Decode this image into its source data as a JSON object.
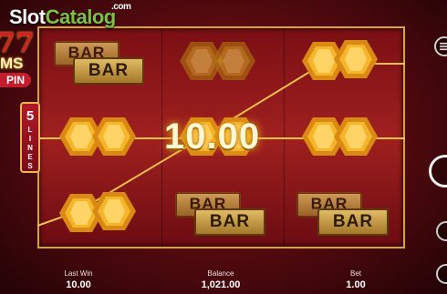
{
  "watermark": {
    "slot": "Slot",
    "catalog": "Catalog",
    "dotcom": ".com"
  },
  "game_logo": {
    "sevens": "77",
    "title_fragment": "MS",
    "spin_fragment": "PIN"
  },
  "lines_badge": {
    "number": "5",
    "word": "LINES"
  },
  "win": {
    "amount": "10.00"
  },
  "symbols": {
    "bar_label": "BAR"
  },
  "hud": {
    "last_win_label": "Last Win",
    "last_win_value": "10.00",
    "balance_label": "Balance",
    "balance_value": "1,021.00",
    "bet_label": "Bet",
    "bet_value": "1.00"
  },
  "colors": {
    "frame_gold": "#d7a531",
    "reel_red": "#a0201f",
    "win_glow": "#f4b728",
    "brand_green": "#7cc242"
  },
  "icons": {
    "menu_button": "menu-icon",
    "spin_button": "spin-icon",
    "autoplay_button": "autoplay-icon"
  }
}
